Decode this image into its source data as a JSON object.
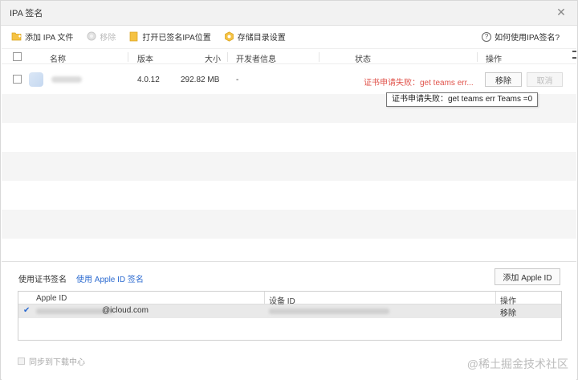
{
  "window": {
    "title": "IPA 签名",
    "close_glyph": "✕"
  },
  "toolbar": {
    "add_ipa": "添加 IPA 文件",
    "remove": "移除",
    "open_signed": "打开已签名IPA位置",
    "storage_settings": "存储目录设置",
    "help": "如何使用IPA签名?"
  },
  "table": {
    "columns": [
      "名称",
      "版本",
      "大小",
      "开发者信息",
      "状态",
      "操作"
    ],
    "rows": [
      {
        "version": "4.0.12",
        "size": "292.82 MB",
        "developer": "-",
        "status": "证书申请失败：get teams err...",
        "remove_label": "移除",
        "cancel_label": "取消"
      }
    ]
  },
  "tooltip": {
    "text": "证书申请失败：get teams err Teams =0"
  },
  "signing": {
    "tab_cert": "使用证书签名",
    "tab_apple_id": "使用 Apple ID 签名",
    "add_apple_id": "添加 Apple ID",
    "columns": [
      "Apple ID",
      "设备 ID",
      "操作"
    ],
    "rows": [
      {
        "email_suffix": "@icloud.com",
        "action": "移除"
      }
    ]
  },
  "sync": {
    "label": "同步到下载中心"
  },
  "watermark": {
    "text": "@稀土掘金技术社区"
  },
  "colors": {
    "error": "#e0524a",
    "link": "#2b6ad0",
    "folder": "#f5c243"
  }
}
